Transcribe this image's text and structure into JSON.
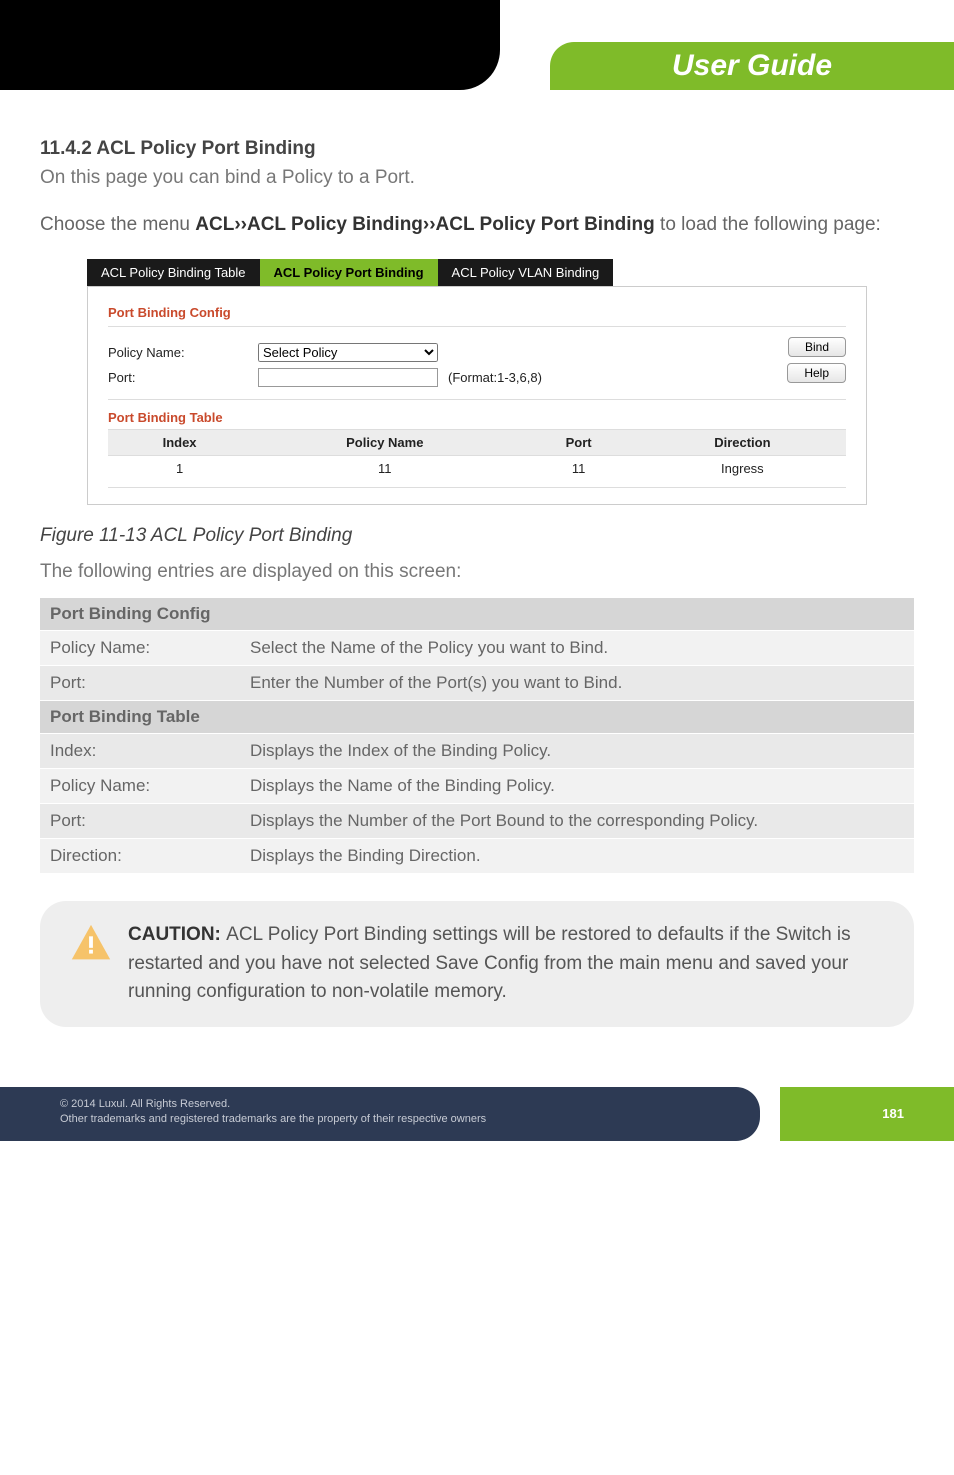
{
  "banner": {
    "title": "User Guide"
  },
  "section": {
    "heading": "11.4.2 ACL Policy Port Binding",
    "intro": "On this page you can bind a Policy to a Port.",
    "menu_prefix": "Choose the menu ",
    "menu_path": "ACL››ACL Policy Binding››ACL Policy Port Binding",
    "menu_suffix": " to load the following page:"
  },
  "screenshot": {
    "tabs": [
      "ACL Policy Binding Table",
      "ACL Policy Port Binding",
      "ACL Policy VLAN Binding"
    ],
    "active_tab_index": 1,
    "config_title": "Port Binding Config",
    "policy_label": "Policy Name:",
    "policy_select_placeholder": "Select Policy",
    "port_label": "Port:",
    "port_value": "",
    "format_hint": "(Format:1-3,6,8)",
    "bind_btn": "Bind",
    "help_btn": "Help",
    "table_title": "Port Binding Table",
    "table_headers": [
      "Index",
      "Policy Name",
      "Port",
      "Direction"
    ],
    "table_rows": [
      {
        "index": "1",
        "policy": "11",
        "port": "11",
        "direction": "Ingress"
      }
    ]
  },
  "figure_caption": "Figure 11-13 ACL Policy Port Binding",
  "entries_intro": "The following entries are displayed on this screen:",
  "desc": {
    "h1": "Port Binding Config",
    "rows1": [
      {
        "k": "Policy Name:",
        "v": "Select the Name of the Policy you want to Bind."
      },
      {
        "k": "Port:",
        "v": "Enter the Number of the Port(s) you want to Bind."
      }
    ],
    "h2": "Port Binding Table",
    "rows2": [
      {
        "k": "Index:",
        "v": "Displays the Index of the Binding Policy."
      },
      {
        "k": "Policy Name:",
        "v": "Displays the Name of the Binding Policy."
      },
      {
        "k": "Port:",
        "v": "Displays the Number of the Port Bound to the corresponding Policy."
      },
      {
        "k": "Direction:",
        "v": "Displays the Binding Direction."
      }
    ]
  },
  "caution": {
    "label": "CAUTION: ",
    "text": "ACL Policy Port Binding settings will be restored to defaults if the Switch is restarted and you have not selected Save Config from the main menu and saved your running configuration to non-volatile memory."
  },
  "footer": {
    "line1": "© 2014  Luxul. All Rights Reserved.",
    "line2": "Other trademarks and registered trademarks are the property of their respective owners",
    "page": "181"
  }
}
